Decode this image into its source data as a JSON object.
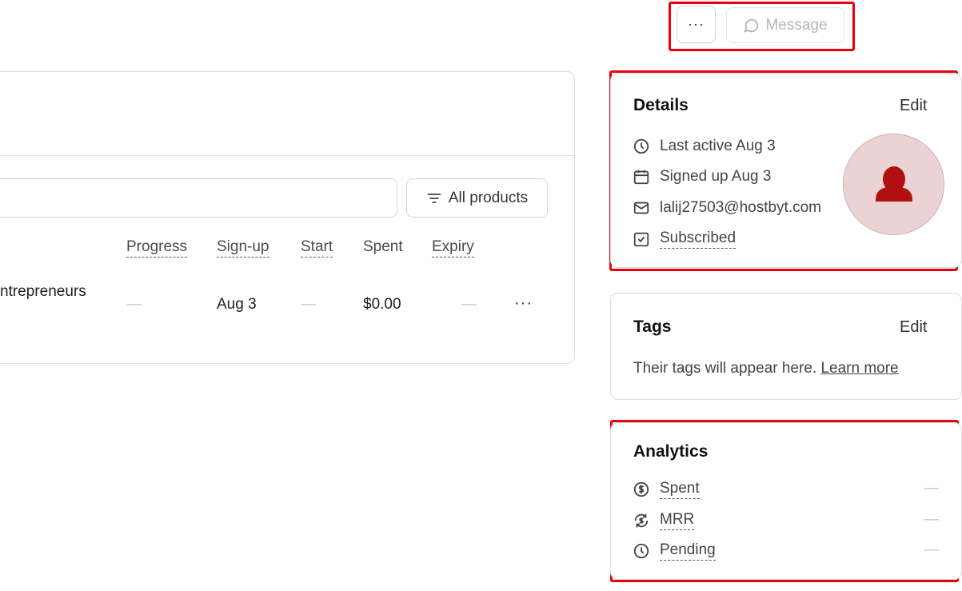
{
  "header": {
    "more_label": "···",
    "message_label": "Message"
  },
  "main": {
    "filter_label": "All products",
    "columns": {
      "progress": "Progress",
      "signup": "Sign-up",
      "start": "Start",
      "spent": "Spent",
      "expiry": "Expiry"
    },
    "row": {
      "product": "ntrepreneurs",
      "progress": "—",
      "signup": "Aug 3",
      "start": "—",
      "spent": "$0.00",
      "expiry": "—",
      "more": "···"
    }
  },
  "details": {
    "title": "Details",
    "edit": "Edit",
    "last_active": "Last active Aug 3",
    "signed_up": "Signed up Aug 3",
    "email": "lalij27503@hostbyt.com",
    "subscribed": "Subscribed"
  },
  "tags": {
    "title": "Tags",
    "edit": "Edit",
    "text": "Their tags will appear here.",
    "link": "Learn more"
  },
  "analytics": {
    "title": "Analytics",
    "rows": [
      {
        "label": "Spent",
        "value": "—"
      },
      {
        "label": "MRR",
        "value": "—"
      },
      {
        "label": "Pending",
        "value": "—"
      }
    ]
  },
  "colors": {
    "highlight": "#e8000b",
    "avatar_bg": "#ecd3d3",
    "avatar_icon": "#b01010"
  }
}
